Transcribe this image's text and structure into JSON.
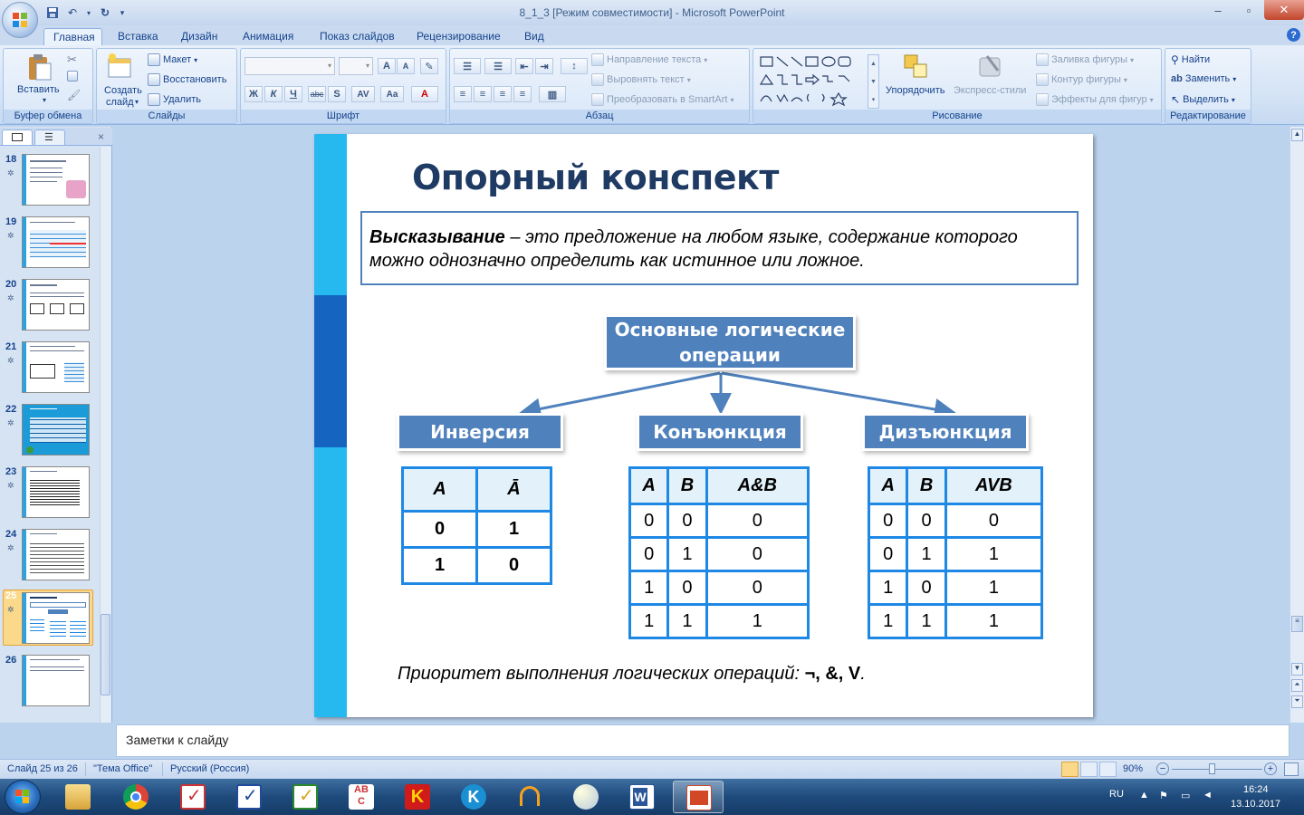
{
  "window": {
    "title": "8_1_3 [Режим совместимости] - Microsoft PowerPoint"
  },
  "tabs": [
    "Главная",
    "Вставка",
    "Дизайн",
    "Анимация",
    "Показ слайдов",
    "Рецензирование",
    "Вид"
  ],
  "ribbon": {
    "clipboard": {
      "label": "Буфер обмена",
      "paste": "Вставить"
    },
    "slides": {
      "label": "Слайды",
      "new_slide": "Создать",
      "new_slide2": "слайд",
      "layout": "Макет",
      "reset": "Восстановить",
      "delete": "Удалить"
    },
    "font": {
      "label": "Шрифт",
      "bold": "Ж",
      "italic": "К",
      "underline": "Ч",
      "strike": "abc",
      "shadow": "S",
      "spacing": "AV",
      "case": "Aa"
    },
    "paragraph": {
      "label": "Абзац",
      "text_direction": "Направление текста",
      "align_text": "Выровнять текст",
      "smartart": "Преобразовать в SmartArt"
    },
    "drawing": {
      "label": "Рисование",
      "arrange": "Упорядочить",
      "quick_styles": "Экспресс-стили",
      "fill": "Заливка фигуры",
      "outline": "Контур фигуры",
      "effects": "Эффекты для фигур"
    },
    "editing": {
      "label": "Редактирование",
      "find": "Найти",
      "replace": "Заменить",
      "select": "Выделить"
    }
  },
  "thumbnails": [
    {
      "num": "18",
      "title": "Решение логических задач"
    },
    {
      "num": "19",
      "title": ""
    },
    {
      "num": "20",
      "title": "Логические элементы"
    },
    {
      "num": "21",
      "title": "Анализ логической схемы"
    },
    {
      "num": "22",
      "title": "Самое главное"
    },
    {
      "num": "23",
      "title": "Вопросы и задания"
    },
    {
      "num": "24",
      "title": "Вопросы и задания"
    },
    {
      "num": "25",
      "title": "Опорный конспект"
    },
    {
      "num": "26",
      "title": "Электронное приложение к уроку"
    }
  ],
  "slide": {
    "title": "Опорный конспект",
    "definition_term": "Высказывание",
    "definition_text": " – это предложение на любом языке, содержание которого можно однозначно определить как истинное или ложное.",
    "main_box": "Основные логические операции",
    "ops": [
      "Инверсия",
      "Конъюнкция",
      "Дизъюнкция"
    ],
    "inversion_table": {
      "headers": [
        "A",
        "Ā"
      ],
      "rows": [
        [
          "0",
          "1"
        ],
        [
          "1",
          "0"
        ]
      ]
    },
    "conjunction_table": {
      "headers": [
        "A",
        "B",
        "A&B"
      ],
      "rows": [
        [
          "0",
          "0",
          "0"
        ],
        [
          "0",
          "1",
          "0"
        ],
        [
          "1",
          "0",
          "0"
        ],
        [
          "1",
          "1",
          "1"
        ]
      ]
    },
    "disjunction_table": {
      "headers": [
        "A",
        "B",
        "AVB"
      ],
      "rows": [
        [
          "0",
          "0",
          "0"
        ],
        [
          "0",
          "1",
          "1"
        ],
        [
          "1",
          "0",
          "1"
        ],
        [
          "1",
          "1",
          "1"
        ]
      ]
    },
    "priority_text": "Приоритет выполнения логических операций: ",
    "priority_ops": "¬, &, V",
    "priority_end": "."
  },
  "notes_placeholder": "Заметки к слайду",
  "status": {
    "slide": "Слайд 25 из 26",
    "theme": "\"Тема Office\"",
    "lang": "Русский (Россия)",
    "zoom": "90%",
    "zoom_fraction": 0.9
  },
  "tray": {
    "lang": "RU",
    "time": "16:24",
    "date": "13.10.2017"
  }
}
